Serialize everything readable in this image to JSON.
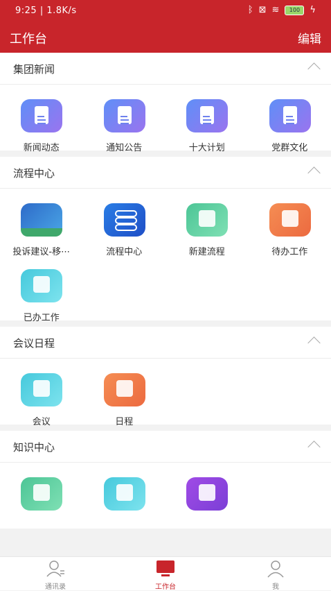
{
  "status_bar": {
    "time_speed": "9:25 | 1.8K/s",
    "battery": "100"
  },
  "header": {
    "title": "工作台",
    "edit_label": "编辑"
  },
  "sections": [
    {
      "title": "集团新闻",
      "items": [
        "新闻动态",
        "通知公告",
        "十大计划",
        "党群文化"
      ]
    },
    {
      "title": "流程中心",
      "items": [
        "投诉建议-移⋯",
        "流程中心",
        "新建流程",
        "待办工作",
        "已办工作"
      ]
    },
    {
      "title": "会议日程",
      "items": [
        "会议",
        "日程"
      ]
    },
    {
      "title": "知识中心",
      "items": []
    }
  ],
  "tabs": [
    {
      "label": "通讯录",
      "icon": "contacts-icon"
    },
    {
      "label": "工作台",
      "icon": "workbench-icon"
    },
    {
      "label": "我",
      "icon": "profile-icon"
    }
  ],
  "colors": {
    "brand": "#c8252b",
    "background": "#f2f2f2"
  }
}
